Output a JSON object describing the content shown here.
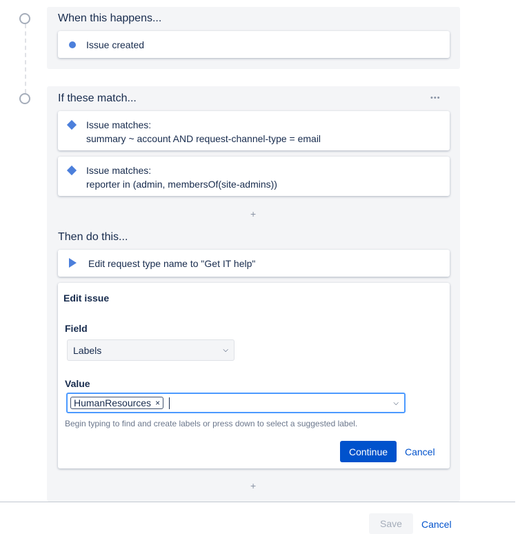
{
  "trigger": {
    "heading": "When this happens...",
    "item": "Issue created"
  },
  "conditions": {
    "heading": "If these match...",
    "more": "•••",
    "items": [
      {
        "title": "Issue matches:",
        "query": "summary ~ account AND request-channel-type = email"
      },
      {
        "title": "Issue matches:",
        "query": "reporter in (admin, membersOf(site-admins))"
      }
    ],
    "add": "+"
  },
  "actions": {
    "heading": "Then do this...",
    "item": "Edit request type name to \"Get IT help\"",
    "add": "+"
  },
  "edit_issue": {
    "title": "Edit issue",
    "field_label": "Field",
    "field_value": "Labels",
    "value_label": "Value",
    "tag": "HumanResources",
    "tag_remove": "×",
    "help": "Begin typing to find and create labels or press down to select a suggested label.",
    "continue": "Continue",
    "cancel": "Cancel"
  },
  "footer": {
    "save": "Save",
    "cancel": "Cancel"
  },
  "colors": {
    "accent": "#4c7fdb",
    "primary": "#0052cc",
    "focus": "#4c9aff"
  }
}
